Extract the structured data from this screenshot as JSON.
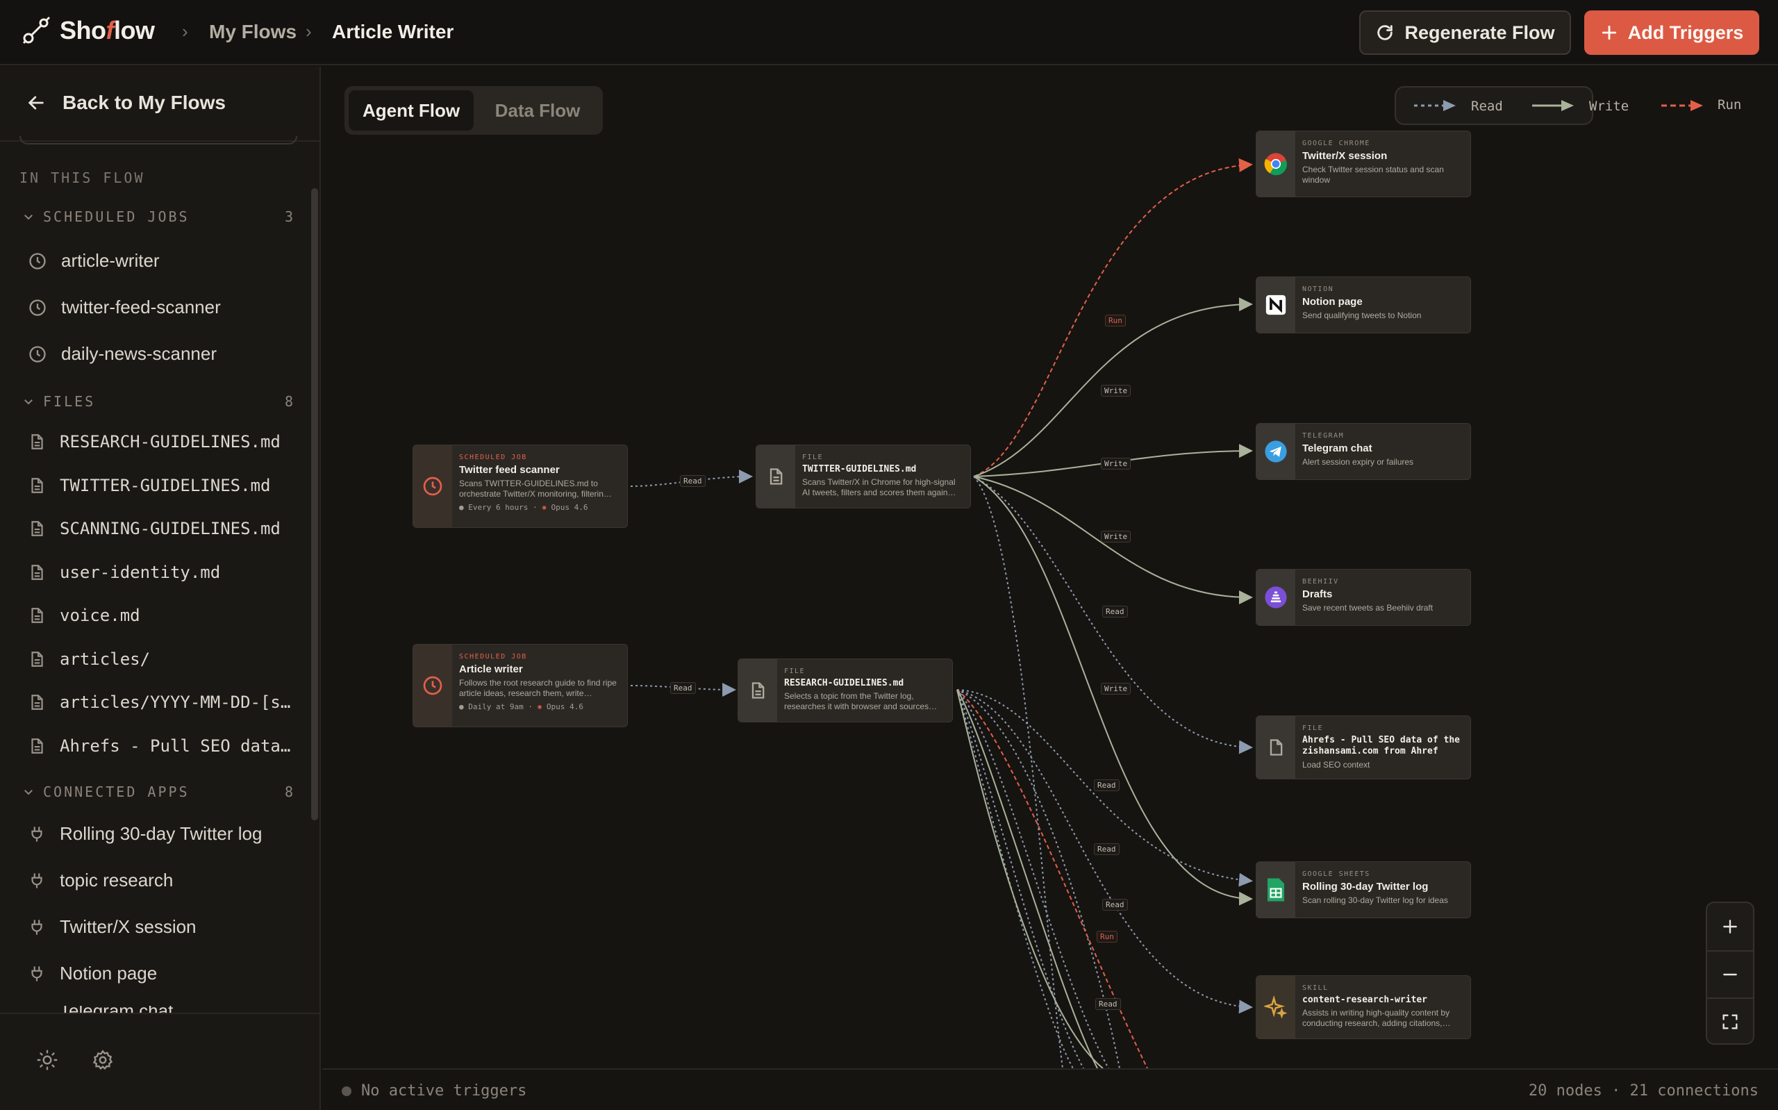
{
  "header": {
    "brand_prefix": "Sho",
    "brand_accent": "f",
    "brand_suffix": "low",
    "breadcrumb_parent": "My Flows",
    "breadcrumb_current": "Article Writer",
    "regenerate_label": "Regenerate Flow",
    "add_triggers_label": "Add Triggers"
  },
  "sidebar": {
    "back_label": "Back to My Flows",
    "section_label": "IN THIS FLOW",
    "groups": [
      {
        "label": "SCHEDULED JOBS",
        "count": "3",
        "items": [
          "article-writer",
          "twitter-feed-scanner",
          "daily-news-scanner"
        ]
      },
      {
        "label": "FILES",
        "count": "8",
        "items": [
          "RESEARCH-GUIDELINES.md",
          "TWITTER-GUIDELINES.md",
          "SCANNING-GUIDELINES.md",
          "user-identity.md",
          "voice.md",
          "articles/",
          "articles/YYYY-MM-DD-[s…",
          "Ahrefs - Pull SEO data…"
        ]
      },
      {
        "label": "CONNECTED APPS",
        "count": "8",
        "items": [
          "Rolling 30-day Twitter log",
          "topic research",
          "Twitter/X session",
          "Notion page",
          "Telegram chat"
        ]
      }
    ]
  },
  "canvas": {
    "tabs": {
      "active": "Agent Flow",
      "inactive": "Data Flow"
    },
    "legend": {
      "read": "Read",
      "write": "Write",
      "run": "Run"
    },
    "edge_labels": {
      "read": "Read",
      "write": "Write",
      "run": "Run"
    },
    "nodes": {
      "twitter_scanner": {
        "type": "SCHEDULED JOB",
        "title": "Twitter feed scanner",
        "desc": "Scans TWITTER-GUIDELINES.md to orchestrate Twitter/X monitoring, filterin…",
        "schedule": "Every 6 hours",
        "model": "Opus 4.6"
      },
      "article_writer": {
        "type": "SCHEDULED JOB",
        "title": "Article writer",
        "desc": "Follows the root research guide to find ripe article ideas, research them, write…",
        "schedule": "Daily at 9am",
        "model": "Opus 4.6"
      },
      "twitter_guidelines": {
        "type": "FILE",
        "title": "TWITTER-GUIDELINES.md",
        "desc": "Scans Twitter/X in Chrome for high-signal AI tweets, filters and scores them again…"
      },
      "research_guidelines": {
        "type": "FILE",
        "title": "RESEARCH-GUIDELINES.md",
        "desc": "Selects a topic from the Twitter log, researches it with browser and sources…"
      },
      "twitter_session": {
        "type": "GOOGLE CHROME",
        "title": "Twitter/X session",
        "desc": "Check Twitter session status and scan window"
      },
      "notion_page": {
        "type": "NOTION",
        "title": "Notion page",
        "desc": "Send qualifying tweets to Notion"
      },
      "telegram_chat": {
        "type": "TELEGRAM",
        "title": "Telegram chat",
        "desc": "Alert session expiry or failures"
      },
      "drafts": {
        "type": "BEEHIIV",
        "title": "Drafts",
        "desc": "Save recent tweets as Beehiiv draft"
      },
      "ahrefs": {
        "type": "FILE",
        "title": "Ahrefs - Pull SEO data of the zishansami.com from Ahref",
        "desc": "Load SEO context"
      },
      "twitter_log": {
        "type": "GOOGLE SHEETS",
        "title": "Rolling 30-day Twitter log",
        "desc": "Scan rolling 30-day Twitter log for ideas"
      },
      "skill": {
        "type": "SKILL",
        "title": "content-research-writer",
        "desc": "Assists in writing high-quality content by conducting research, adding citations,…"
      }
    }
  },
  "status": {
    "triggers": "No active triggers",
    "summary": "20 nodes · 21 connections"
  },
  "colors": {
    "accent": "#dc5a44",
    "read_edge": "#8d9bb0",
    "write_edge": "#a9b29a",
    "run_edge": "#e2604a"
  },
  "icons": {
    "logo": "flow-logo-icon",
    "regenerate": "refresh-icon",
    "add": "plus-icon",
    "back": "arrow-left-icon",
    "job": "clock-icon",
    "file": "file-icon",
    "app": "plug-icon"
  }
}
